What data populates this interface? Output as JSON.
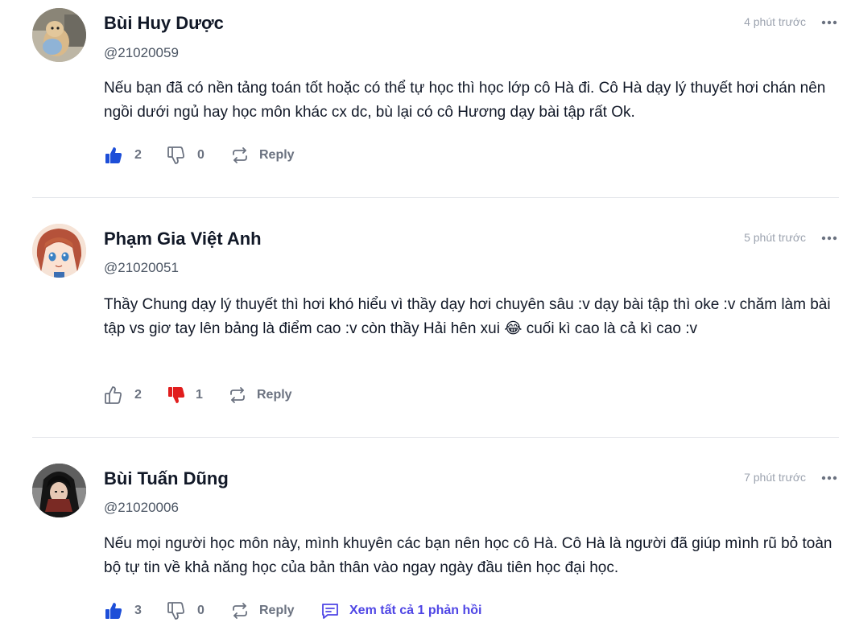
{
  "comments": [
    {
      "name": "Bùi Huy Dược",
      "handle": "@21020059",
      "time": "4 phút trước",
      "text": "Nếu bạn đã có nền tảng toán tốt hoặc có thể tự học thì học lớp cô Hà đi. Cô Hà dạy lý thuyết hơi chán nên ngồi dưới ngủ hay học môn khác cx dc, bù lại có cô Hương dạy bài tập rất Ok.",
      "likes": "2",
      "dislikes": "0",
      "reply_label": "Reply",
      "liked": true,
      "disliked": false
    },
    {
      "name": "Phạm Gia Việt Anh",
      "handle": "@21020051",
      "time": "5 phút trước",
      "text_before_emoji": "Thầy Chung dạy lý thuyết thì hơi khó hiểu vì thầy dạy hơi chuyên sâu :v dạy bài tập thì oke :v chăm làm bài tập vs giơ tay lên bảng là điểm cao :v còn thầy Hải hên xui ",
      "emoji": "😂",
      "text_after_emoji": " cuối kì cao là cả kì cao :v",
      "likes": "2",
      "dislikes": "1",
      "reply_label": "Reply",
      "liked": false,
      "disliked": true
    },
    {
      "name": "Bùi Tuấn Dũng",
      "handle": "@21020006",
      "time": "7 phút trước",
      "text": "Nếu mọi người học môn này, mình khuyên các bạn nên học cô Hà. Cô Hà là người đã giúp mình rũ bỏ toàn bộ tự tin về khả năng học của bản thân vào ngay ngày đầu tiên học đại học.",
      "likes": "3",
      "dislikes": "0",
      "reply_label": "Reply",
      "view_replies_label": "Xem tất cả 1 phản hồi",
      "liked": true,
      "disliked": false
    }
  ],
  "colors": {
    "like_active": "#1d4ed8",
    "dislike_active": "#e11d1d",
    "icon_inactive": "#6b7280",
    "replies_link": "#4f46e5"
  },
  "icons": [
    "thumbs-up-icon",
    "thumbs-down-icon",
    "reply-icon",
    "more-horizontal-icon",
    "comment-icon"
  ]
}
